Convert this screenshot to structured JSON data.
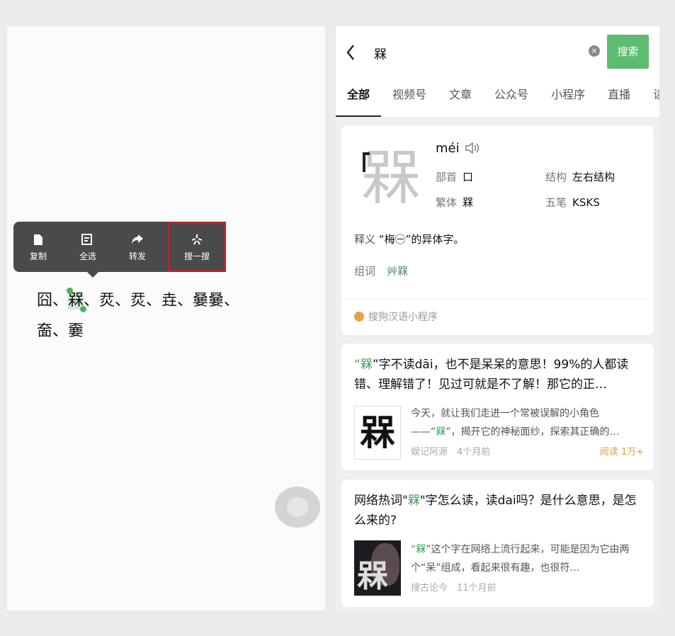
{
  "left": {
    "menu": [
      "复制",
      "全选",
      "转发",
      "搜一搜"
    ],
    "line1_before": "囧、",
    "line1_selected": "槑",
    "line1_after": "、烎、烎、垚、嘦嘦、",
    "line2": "奤、嫑"
  },
  "search": {
    "back_icon": "chevron-left",
    "query": "槑",
    "clear_icon": "×",
    "button": "搜索"
  },
  "tabs": [
    "全部",
    "视频号",
    "文章",
    "公众号",
    "小程序",
    "直播",
    "读"
  ],
  "dict": {
    "char": "槑",
    "pinyin": "méi",
    "radical_label": "部首",
    "radical": "口",
    "structure_label": "结构",
    "structure": "左右结构",
    "trad_label": "繁体",
    "trad": "槑",
    "wubi_label": "五笔",
    "wubi": "KSKS",
    "def_label": "释义",
    "def": "“梅㊀”的异体字。",
    "zuci_label": "组词",
    "zuci": "艸槑",
    "source": "搜狗汉语小程序"
  },
  "article1": {
    "title_q1": "“",
    "title_char": "槑",
    "title_rest": "”字不读dāi，也不是呆呆的意思！99%的人都读错、理解错了！见过可就是不了解！那它的正…",
    "thumb": "槑",
    "desc_1": "今天，就让我们走进一个常被误解的小角色——“",
    "desc_char": "槑",
    "desc_2": "”，揭开它的神秘面纱，探索其正确的…",
    "meta": "娱记阿源　4个月前",
    "reads": "阅读 1万+"
  },
  "article2": {
    "title_1": "网络热词\"",
    "title_char": "槑",
    "title_2": "\"字怎么读，读dai吗？是什么意思，是怎么来的?",
    "thumb": "槑",
    "desc_q": "“",
    "desc_char": "槑",
    "desc_rest": "”这个字在网络上流行起来，可能是因为它由两个“呆”组成，看起来很有趣，也很符…",
    "meta": "搜古论今　11个月前"
  }
}
